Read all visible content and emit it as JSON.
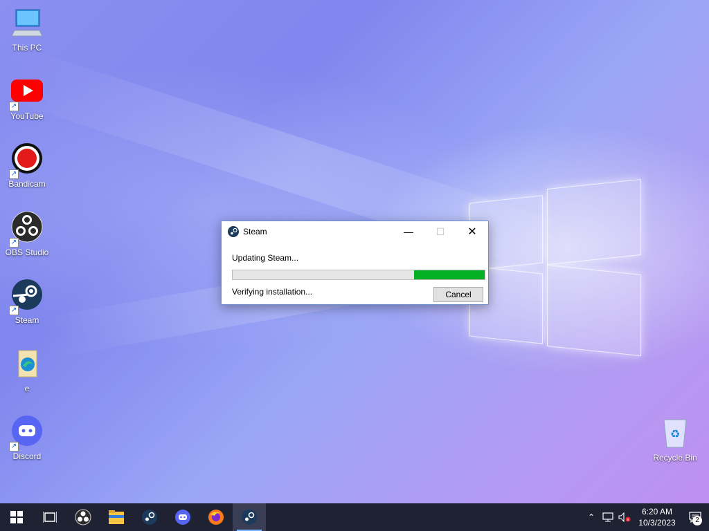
{
  "desktop": {
    "icons": [
      {
        "label": "This PC",
        "icon": "computer-icon"
      },
      {
        "label": "YouTube",
        "icon": "youtube-icon"
      },
      {
        "label": "Bandicam",
        "icon": "bandicam-icon"
      },
      {
        "label": "OBS Studio",
        "icon": "obs-icon"
      },
      {
        "label": "Steam",
        "icon": "steam-icon"
      },
      {
        "label": "e",
        "icon": "edge-file-icon"
      },
      {
        "label": "Discord",
        "icon": "discord-icon"
      }
    ],
    "recycle_bin": {
      "label": "Recycle Bin",
      "icon": "recycle-bin-icon"
    }
  },
  "dialog": {
    "title": "Steam",
    "status": "Updating Steam...",
    "progress_percent": 28,
    "substatus": "Verifying installation...",
    "cancel_label": "Cancel",
    "progress_color": "#06b025"
  },
  "taskbar": {
    "items": [
      "start-icon",
      "task-view-icon",
      "obs-icon",
      "file-explorer-icon",
      "steam-icon",
      "discord-icon",
      "firefox-icon",
      "steam-icon"
    ],
    "active_item": "steam-icon",
    "clock": {
      "time": "6:20 AM",
      "date": "10/3/2023"
    },
    "notifications_count": "2"
  }
}
